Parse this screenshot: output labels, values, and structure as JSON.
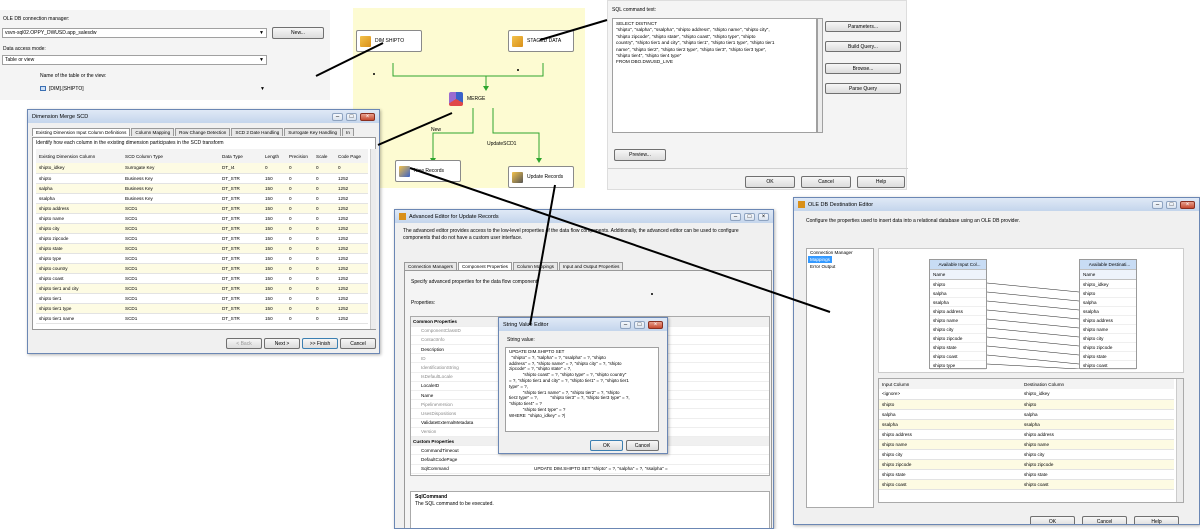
{
  "oledb_conn": {
    "conn_label": "OLE DB connection manager:",
    "conn_value": "vsvn-sql02.OPPY_DWUSD.app_salesdw",
    "new_button": "New...",
    "access_label": "Data access mode:",
    "access_value": "Table or view",
    "table_label": "Name of the table or the view:",
    "table_value": "[DIM].[SHIPTO]"
  },
  "sql_panel": {
    "label": "SQL command text:",
    "text": "SELECT DISTINCT\n\"shipto\", \"salpha\", \"ssalpha\", \"shipto address\", \"shipto name\", \"shipto city\",\n\"shipto zipcode\", \"shipto state\", \"shipto coast\", \"shipto type\", \"shipto\ncountry\", \"shipto tier1 and city\", \"shipto tier1\", \"shipto tier1 type\", \"shipto tier1\nname\", \"shipto tier2\", \"shipto tier2 type\", \"shipto tier3\", \"shipto tier3 type\",\n\"shipto tier4\", \"shipto tier4 type\"\nFROM DBO.DWUSD_LIVE",
    "buttons": [
      "Parameters...",
      "Build Query...",
      "Browse...",
      "Parse Query"
    ],
    "preview": "Preview...",
    "ok": "OK",
    "cancel": "Cancel",
    "help": "Help"
  },
  "flow": {
    "dim_shipto": "DIM SHIPTO",
    "staged_data": "STAGED DATA",
    "merge": "MERGE",
    "new_label": "New",
    "update_label": "UpdateSCD1",
    "new_records": "New Records",
    "update_records": "Update Records"
  },
  "scd": {
    "title": "Dimension Merge SCD",
    "tabs": [
      "Existing Dimension Input Column Definitions",
      "Column Mapping",
      "Row Change Detection",
      "SCD 2 Date Handling",
      "Surrogate Key Handling",
      "In"
    ],
    "description": "Identify how each column in the existing dimension participates in the SCD transform",
    "headers": [
      "Existing Dimension Column",
      "SCD Column Type",
      "Data Type",
      "Length",
      "Precision",
      "Scale",
      "Code Page"
    ],
    "rows": [
      [
        "shipto_idkey",
        "Surrogate Key",
        "DT_I4",
        "0",
        "0",
        "0",
        "0"
      ],
      [
        "shipto",
        "Business Key",
        "DT_STR",
        "150",
        "0",
        "0",
        "1252"
      ],
      [
        "salpha",
        "Business Key",
        "DT_STR",
        "150",
        "0",
        "0",
        "1252"
      ],
      [
        "ssalpha",
        "Business Key",
        "DT_STR",
        "150",
        "0",
        "0",
        "1252"
      ],
      [
        "shipto address",
        "SCD1",
        "DT_STR",
        "150",
        "0",
        "0",
        "1252"
      ],
      [
        "shipto name",
        "SCD1",
        "DT_STR",
        "150",
        "0",
        "0",
        "1252"
      ],
      [
        "shipto city",
        "SCD1",
        "DT_STR",
        "150",
        "0",
        "0",
        "1252"
      ],
      [
        "shipto zipcode",
        "SCD1",
        "DT_STR",
        "150",
        "0",
        "0",
        "1252"
      ],
      [
        "shipto state",
        "SCD1",
        "DT_STR",
        "150",
        "0",
        "0",
        "1252"
      ],
      [
        "shipto type",
        "SCD1",
        "DT_STR",
        "150",
        "0",
        "0",
        "1252"
      ],
      [
        "shipto country",
        "SCD1",
        "DT_STR",
        "150",
        "0",
        "0",
        "1252"
      ],
      [
        "shipto coast",
        "SCD1",
        "DT_STR",
        "150",
        "0",
        "0",
        "1252"
      ],
      [
        "shipto tier1 and city",
        "SCD1",
        "DT_STR",
        "150",
        "0",
        "0",
        "1252"
      ],
      [
        "shipto tier1",
        "SCD1",
        "DT_STR",
        "150",
        "0",
        "0",
        "1252"
      ],
      [
        "shipto tier1 type",
        "SCD1",
        "DT_STR",
        "150",
        "0",
        "0",
        "1252"
      ],
      [
        "shipto tier1 name",
        "SCD1",
        "DT_STR",
        "150",
        "0",
        "0",
        "1252"
      ]
    ],
    "back": "< Back",
    "next": "Next >",
    "finish": ">> Finish",
    "cancel": "Cancel"
  },
  "adv": {
    "title": "Advanced Editor for Update Records",
    "description": "The advanced editor provides access to the low-level properties of the data flow components. Additionally, the advanced editor can be used to configure components that do not have a custom user interface.",
    "tabs": [
      "Connection Managers",
      "Component Properties",
      "Column Mappings",
      "Input and Output Properties"
    ],
    "specify": "Specify advanced properties for the data flow component.",
    "properties_label": "Properties:",
    "common_header": "Common Properties",
    "common_props": [
      "ComponentClassID",
      "ContactInfo",
      "Description",
      "ID",
      "IdentificationString",
      "IsDefaultLocale",
      "LocaleID",
      "Name",
      "PipelineVersion",
      "UsesDispositions",
      "ValidateExternalMetadata",
      "Version"
    ],
    "common_values": [
      "B731CC)",
      "ation; Microsoft SqlServer v10; (C",
      "row in a dataset."
    ],
    "custom_header": "Custom Properties",
    "custom_props": [
      "CommandTimeout",
      "DefaultCodePage",
      "SqlCommand"
    ],
    "sql_value": "UPDATE DIM.SHIPTO SET  \"shipto\" = ?, \"salpha\" = ?, \"ssalpha\" =",
    "desc_title": "SqlCommand",
    "desc_text": "The SQL command to be executed."
  },
  "strval": {
    "title": "String Value Editor",
    "label": "String value:",
    "text": "UPDATE DIM.SHIPTO SET\n  \"shipto\" = ?, \"salpha\" = ?, \"ssalpha\" = ?, \"shipto\naddress\" = ?, \"shipto name\" = ?, \"shipto city\" = ?, \"shipto\nzipcode\" = ?, \"shipto state\" = ?,\n           \"shipto coast\" = ?, \"shipto type\" = ?, \"shipto country\"\n= ?, \"shipto tier1 and city\" = ?, \"shipto tier1\" = ?, \"shipto tier1\ntype\" = ?,\n           \"shipto tier1 name\" = ?, \"shipto tier2\" = ?, \"shipto\ntier2 type\" = ?,          \"shipto tier3\" = ?, \"shipto tier3 type\" = ?,\n\"shipto tier4\" = ?\n           \"shipto tier4 type\" = ?\nWHERE  \"shipto_idkey\" = ?|",
    "ok": "OK",
    "cancel": "Cancel"
  },
  "dest": {
    "title": "OLE DB Destination Editor",
    "description": "Configure the properties used to insert data into a relational database using an OLE DB provider.",
    "nav": [
      "Connection Manager",
      "Mappings",
      "Error Output"
    ],
    "avail_input_title": "Available Input Col...",
    "avail_dest_title": "Available Destinati...",
    "name_header": "Name",
    "input_cols": [
      "shipto",
      "salpha",
      "ssalpha",
      "shipto address",
      "shipto name",
      "shipto city",
      "shipto zipcode",
      "shipto state",
      "shipto coast",
      "shipto type"
    ],
    "dest_cols": [
      "shipto_idkey",
      "shipto",
      "salpha",
      "ssalpha",
      "shipto address",
      "shipto name",
      "shipto city",
      "shipto zipcode",
      "shipto state",
      "shipto coast"
    ],
    "grid_headers": [
      "Input Column",
      "Destination Column"
    ],
    "grid_rows": [
      [
        "<ignore>",
        "shipto_idkey"
      ],
      [
        "shipto",
        "shipto"
      ],
      [
        "salpha",
        "salpha"
      ],
      [
        "ssalpha",
        "ssalpha"
      ],
      [
        "shipto address",
        "shipto address"
      ],
      [
        "shipto name",
        "shipto name"
      ],
      [
        "shipto city",
        "shipto city"
      ],
      [
        "shipto zipcode",
        "shipto zipcode"
      ],
      [
        "shipto state",
        "shipto state"
      ],
      [
        "shipto coast",
        "shipto coast"
      ]
    ],
    "ok": "OK",
    "cancel": "Cancel",
    "help": "Help"
  }
}
